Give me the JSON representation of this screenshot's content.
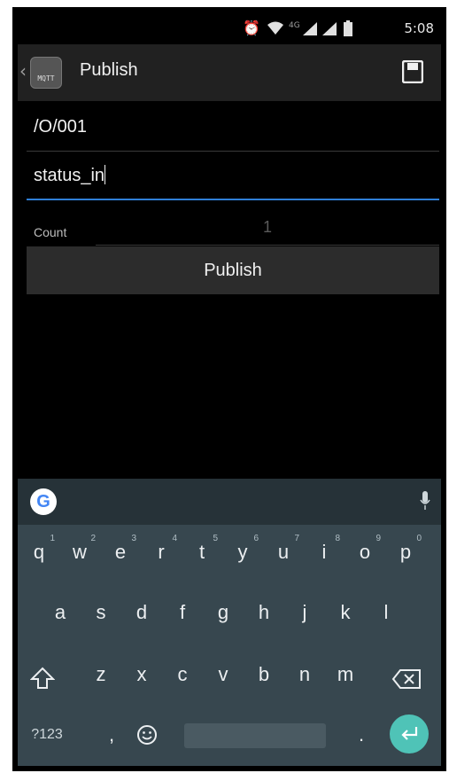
{
  "status_bar": {
    "time": "5:08",
    "signal_label": "4G"
  },
  "app_bar": {
    "icon_label": "MQTT",
    "title": "Publish"
  },
  "form": {
    "topic_value": "/O/001",
    "message_value": "status_in",
    "count_label": "Count",
    "count_value": "1",
    "publish_button": "Publish"
  },
  "keyboard": {
    "google_logo": "G",
    "row1": [
      {
        "key": "q",
        "hint": "1"
      },
      {
        "key": "w",
        "hint": "2"
      },
      {
        "key": "e",
        "hint": "3"
      },
      {
        "key": "r",
        "hint": "4"
      },
      {
        "key": "t",
        "hint": "5"
      },
      {
        "key": "y",
        "hint": "6"
      },
      {
        "key": "u",
        "hint": "7"
      },
      {
        "key": "i",
        "hint": "8"
      },
      {
        "key": "o",
        "hint": "9"
      },
      {
        "key": "p",
        "hint": "0"
      }
    ],
    "row2": [
      "a",
      "s",
      "d",
      "f",
      "g",
      "h",
      "j",
      "k",
      "l"
    ],
    "row3": [
      "z",
      "x",
      "c",
      "v",
      "b",
      "n",
      "m"
    ],
    "symbols_key": "?123",
    "comma_key": ",",
    "period_key": "."
  },
  "colors": {
    "accent": "#2f7fd6",
    "enter": "#4fc3b7",
    "keyboard_bg": "#37474f",
    "appbar_bg": "#212121"
  }
}
